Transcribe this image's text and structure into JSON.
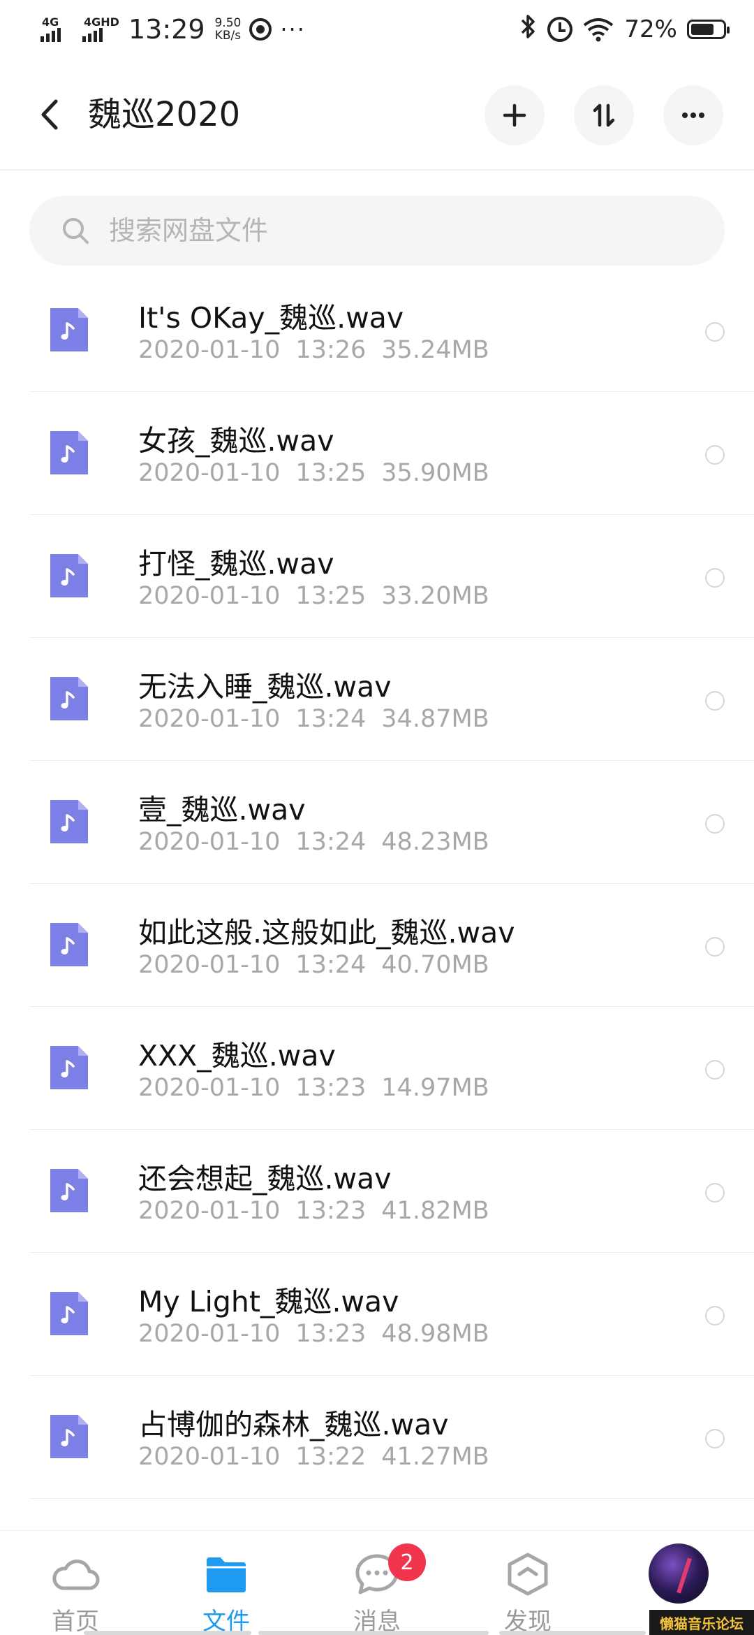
{
  "status_bar": {
    "sim1": "4G",
    "sim2": "4GHD",
    "time": "13:29",
    "speed_value": "9.50",
    "speed_unit": "KB/s",
    "more": "···",
    "battery_pct": "72%",
    "battery_level": 0.72
  },
  "header": {
    "title": "魏巡2020",
    "add_label": "+",
    "sort_label": "⇅",
    "more_label": "···"
  },
  "search": {
    "placeholder": "搜索网盘文件"
  },
  "files": [
    {
      "name": "It's OKay_魏巡.wav",
      "date": "2020-01-10",
      "time": "13:26",
      "size": "35.24MB"
    },
    {
      "name": "女孩_魏巡.wav",
      "date": "2020-01-10",
      "time": "13:25",
      "size": "35.90MB"
    },
    {
      "name": "打怪_魏巡.wav",
      "date": "2020-01-10",
      "time": "13:25",
      "size": "33.20MB"
    },
    {
      "name": "无法入睡_魏巡.wav",
      "date": "2020-01-10",
      "time": "13:24",
      "size": "34.87MB"
    },
    {
      "name": "壹_魏巡.wav",
      "date": "2020-01-10",
      "time": "13:24",
      "size": "48.23MB"
    },
    {
      "name": "如此这般.这般如此_魏巡.wav",
      "date": "2020-01-10",
      "time": "13:24",
      "size": "40.70MB"
    },
    {
      "name": "XXX_魏巡.wav",
      "date": "2020-01-10",
      "time": "13:23",
      "size": "14.97MB"
    },
    {
      "name": "还会想起_魏巡.wav",
      "date": "2020-01-10",
      "time": "13:23",
      "size": "41.82MB"
    },
    {
      "name": "My Light_魏巡.wav",
      "date": "2020-01-10",
      "time": "13:23",
      "size": "48.98MB"
    },
    {
      "name": "占博伽的森林_魏巡.wav",
      "date": "2020-01-10",
      "time": "13:22",
      "size": "41.27MB"
    }
  ],
  "nav": {
    "home": "首页",
    "files": "文件",
    "messages": "消息",
    "messages_badge": "2",
    "discover": "发现"
  },
  "watermark": "懒猫音乐论坛",
  "colors": {
    "accent": "#1e9bf0",
    "file_icon": "#7b7fe6",
    "badge": "#f0354c"
  },
  "icons": {
    "back": "chevron-left-icon",
    "add": "plus-icon",
    "sort": "sort-icon",
    "more": "more-icon",
    "search": "search-icon",
    "file": "music-file-icon",
    "nav_home": "cloud-icon",
    "nav_files": "folder-icon",
    "nav_messages": "chat-icon",
    "nav_discover": "discover-icon"
  }
}
